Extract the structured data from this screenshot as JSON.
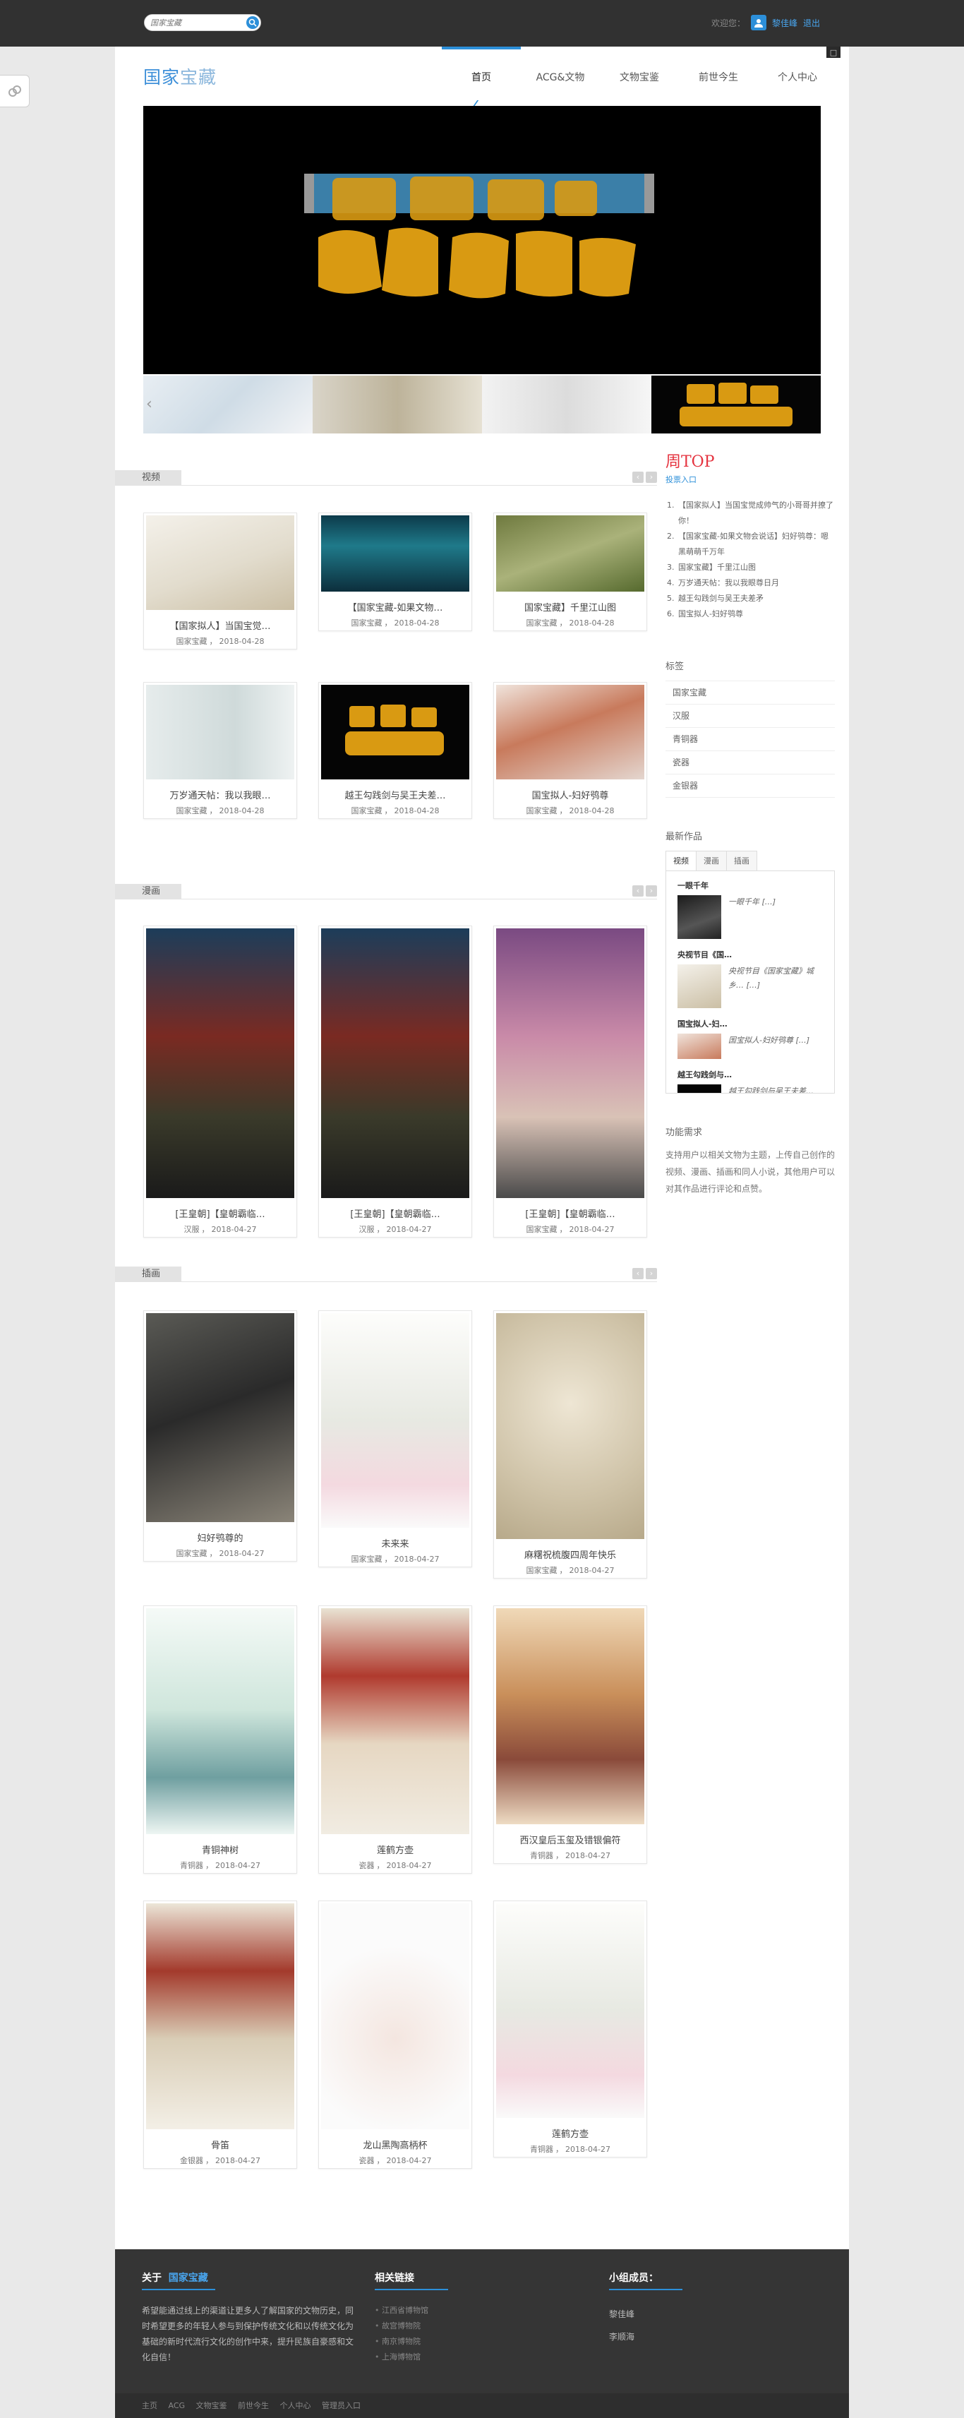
{
  "topbar": {
    "search_placeholder": "国家宝藏",
    "welcome": "欢迎您：",
    "user_name": "黎佳峰",
    "logout": "退出"
  },
  "header": {
    "logo_main": "国家",
    "logo_rest": "宝藏",
    "corner": "□",
    "nav": [
      "首页",
      "ACG&文物",
      "文物宝鉴",
      "前世今生",
      "个人中心"
    ]
  },
  "sections": {
    "video": "视频",
    "comic": "漫画",
    "illustration": "插画"
  },
  "video_cards": [
    {
      "title": "【国家拟人】当国宝觉…",
      "category": "国家宝藏",
      "date": "2018-04-28"
    },
    {
      "title": "【国家宝藏-如果文物…",
      "category": "国家宝藏",
      "date": "2018-04-28"
    },
    {
      "title": "国家宝藏】千里江山图",
      "category": "国家宝藏",
      "date": "2018-04-28"
    },
    {
      "title": "万岁通天帖：我以我眼…",
      "category": "国家宝藏",
      "date": "2018-04-28"
    },
    {
      "title": "越王勾践剑与吴王夫差…",
      "category": "国家宝藏",
      "date": "2018-04-28"
    },
    {
      "title": "国宝拟人-妇好鸮尊",
      "category": "国家宝藏",
      "date": "2018-04-28"
    }
  ],
  "comic_cards": [
    {
      "title": "[王皇朝]【皇朝霸临…",
      "category": "汉服",
      "date": "2018-04-27"
    },
    {
      "title": "[王皇朝]【皇朝霸临…",
      "category": "汉服",
      "date": "2018-04-27"
    },
    {
      "title": "[王皇朝]【皇朝霸临…",
      "category": "国家宝藏",
      "date": "2018-04-27"
    }
  ],
  "illustration_cards": [
    {
      "title": "妇好鸮尊的",
      "category": "国家宝藏",
      "date": "2018-04-27"
    },
    {
      "title": "未来来",
      "category": "国家宝藏",
      "date": "2018-04-27"
    },
    {
      "title": "麻糬祝梳腹四周年快乐",
      "category": "国家宝藏",
      "date": "2018-04-27"
    },
    {
      "title": "青铜神树",
      "category": "青铜器",
      "date": "2018-04-27"
    },
    {
      "title": "莲鹤方壶",
      "category": "瓷器",
      "date": "2018-04-27"
    },
    {
      "title": "西汉皇后玉玺及错银偏符",
      "category": "青铜器",
      "date": "2018-04-27"
    },
    {
      "title": "骨笛",
      "category": "金银器",
      "date": "2018-04-27"
    },
    {
      "title": "龙山黑陶高柄杯",
      "category": "瓷器",
      "date": "2018-04-27"
    },
    {
      "title": "莲鹤方壶",
      "category": "青铜器",
      "date": "2018-04-27"
    }
  ],
  "sidebar": {
    "week_top": "周TOP",
    "vote": "投票入口",
    "rank": [
      "【国家拟人】当国宝觉成帅气的小哥哥并撩了你！",
      "【国家宝藏-如果文物会说话】妇好鸮尊：嗯黑萌萌千万年",
      "国家宝藏】千里江山图",
      "万岁通天帖：我以我眼尊日月",
      "越王勾践剑与吴王夫差矛",
      "国宝拟人-妇好鸮尊"
    ],
    "tags_title": "标签",
    "tags": [
      "国家宝藏",
      "汉服",
      "青铜器",
      "瓷器",
      "金银器"
    ],
    "works_title": "最新作品",
    "work_tabs": [
      "视频",
      "漫画",
      "插画"
    ],
    "works": [
      {
        "title": "一眼千年",
        "desc": "一眼千年 […]"
      },
      {
        "title": "央视节目《国…",
        "desc": "央视节目《国家宝藏》城乡… […]"
      },
      {
        "title": "国宝拟人-妇…",
        "desc": "国宝拟人-妇好鸮尊 […]"
      },
      {
        "title": "越王勾践剑与…",
        "desc": "越王勾践剑与吴王夫差…"
      }
    ],
    "intro_title": "功能需求",
    "intro_text": "支持用户以相关文物为主题，上传自己创作的视频、漫画、插画和同人小说，其他用户可以对其作品进行评论和点赞。"
  },
  "footer": {
    "about_prefix": "关于",
    "about_accent": "国家宝藏",
    "about_text": "希望能通过线上的渠道让更多人了解国家的文物历史，同时希望更多的年轻人参与到保护传统文化和以传统文化为基础的新时代流行文化的创作中来，提升民族自豪感和文化自信！",
    "links_title": "相关链接",
    "links": [
      "江西省博物馆",
      "故宫博物院",
      "南京博物院",
      "上海博物馆"
    ],
    "members_title": "小组成员：",
    "members": [
      "黎佳峰",
      "李顺海"
    ],
    "bottom_links": [
      "主页",
      "ACG",
      "文物宝鉴",
      "前世今生",
      "个人中心",
      "管理员入口"
    ]
  },
  "colors": {
    "accent": "#2c8fd9",
    "hot": "#e5333f",
    "dark_bar": "#313131"
  }
}
